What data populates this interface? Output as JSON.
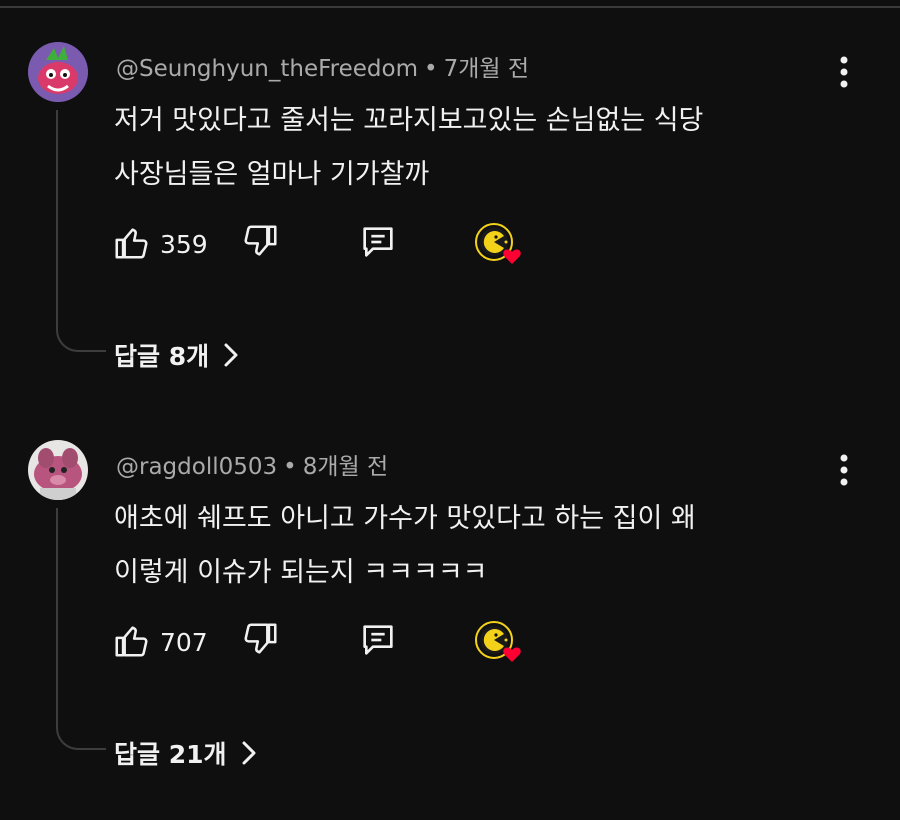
{
  "comments": [
    {
      "author": "@Seunghyun_theFreedom",
      "separator": "•",
      "time_ago": "7개월 전",
      "lines": [
        "저거 맛있다고 줄서는 꼬라지보고있는 손님없는 식당",
        "사장님들은 얼마나 기가찰까"
      ],
      "like_count": "359",
      "replies_label": "답글 8개",
      "avatar_icon": "cartoon-character-avatar",
      "accent": "#ff0033"
    },
    {
      "author": "@ragdoll0503",
      "separator": "•",
      "time_ago": "8개월 전",
      "lines": [
        "애초에 쉐프도 아니고 가수가 맛있다고 하는 집이 왜",
        "이렇게 이슈가 되는지 ㅋㅋㅋㅋㅋ"
      ],
      "like_count": "707",
      "replies_label": "답글 21개",
      "avatar_icon": "pink-plush-avatar",
      "accent": "#ff0033"
    }
  ],
  "icons": {
    "like": "thumbs-up-icon",
    "dislike": "thumbs-down-icon",
    "reply": "comment-icon",
    "more": "more-vertical-icon",
    "creator_heart": "creator-heart-badge",
    "expand": "chevron-right-icon"
  },
  "colors": {
    "background": "#0f0f0f",
    "text_primary": "#f1f1f1",
    "text_secondary": "#aaaaaa",
    "heart": "#ff0033",
    "badge": "#f4d21a"
  }
}
